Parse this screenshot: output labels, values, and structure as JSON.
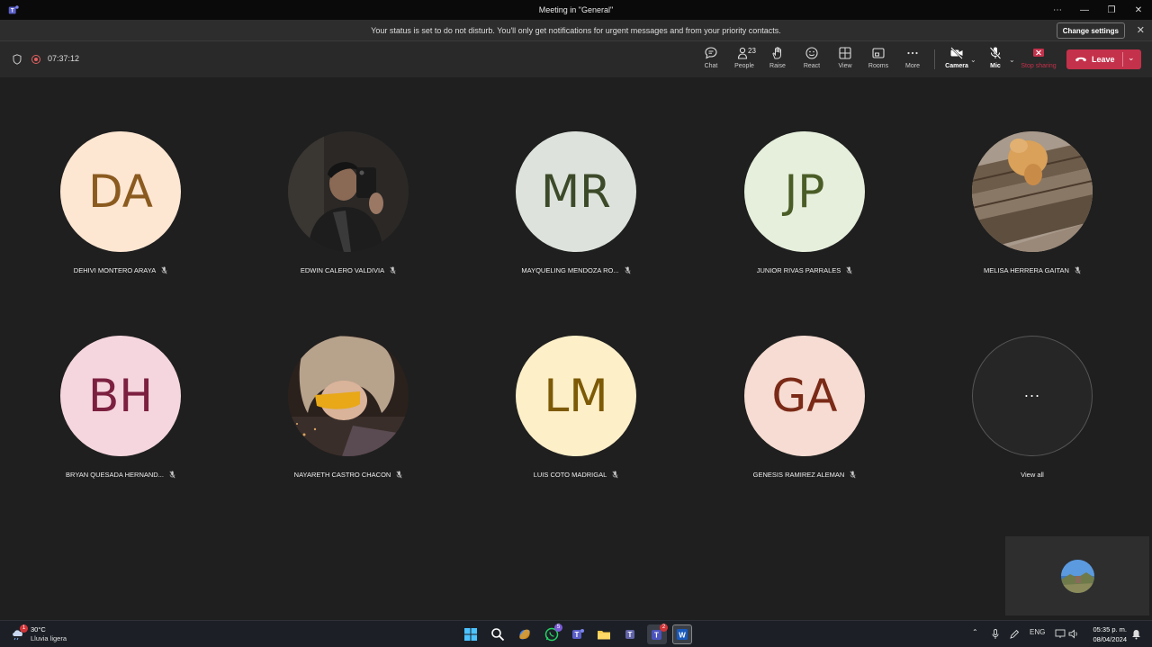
{
  "window": {
    "title": "Meeting in \"General\"",
    "controls": [
      "⋯",
      "—",
      "❐",
      "✕"
    ]
  },
  "notification": {
    "message": "Your status is set to do not disturb. You'll only get notifications for urgent messages and from your priority contacts.",
    "button": "Change settings",
    "close": "✕"
  },
  "meeting": {
    "elapsed": "07:37:12",
    "people_count": "23",
    "buttons": {
      "chat": "Chat",
      "people": "People",
      "raise": "Raise",
      "react": "React",
      "view": "View",
      "rooms": "Rooms",
      "more": "More",
      "camera": "Camera",
      "mic": "Mic",
      "stop_sharing": "Stop sharing",
      "leave": "Leave"
    }
  },
  "participants": [
    {
      "initials": "DA",
      "name": "DEHIVI MONTERO ARAYA",
      "bg": "#fde6d2",
      "fg": "#8a5a1f"
    },
    {
      "initials": "",
      "name": "EDWIN CALERO VALDIVIA",
      "bg": "#2a2a2a",
      "fg": "#ffffff"
    },
    {
      "initials": "MR",
      "name": "MAYQUELING MENDOZA RO...",
      "bg": "#dde3dc",
      "fg": "#3d4a2a"
    },
    {
      "initials": "JP",
      "name": "JUNIOR RIVAS PARRALES",
      "bg": "#e6efdc",
      "fg": "#4b5d27"
    },
    {
      "initials": "",
      "name": "MELISA HERRERA GAITAN",
      "bg": "#8a7a6a",
      "fg": "#ffffff"
    },
    {
      "initials": "BH",
      "name": "BRYAN QUESADA HERNAND...",
      "bg": "#f6d6de",
      "fg": "#7c2040"
    },
    {
      "initials": "",
      "name": "NAYARETH CASTRO CHACON",
      "bg": "#3a2a22",
      "fg": "#ffffff"
    },
    {
      "initials": "LM",
      "name": "LUIS COTO MADRIGAL",
      "bg": "#fdefc8",
      "fg": "#7d5a05"
    },
    {
      "initials": "GA",
      "name": "GENESIS RAMIREZ ALEMAN",
      "bg": "#f6dcd2",
      "fg": "#7a2a17"
    }
  ],
  "view_all": {
    "label": "View all",
    "dots": "..."
  },
  "taskbar": {
    "weather_temp": "30°C",
    "weather_cond": "Lluvia ligera",
    "weather_badge": "1",
    "whatsapp_badge": "5",
    "teams_badge": "2",
    "lang": "ENG",
    "time": "05:35 p. m.",
    "date": "08/04/2024"
  },
  "colors": {
    "accent_leave": "#c4314b",
    "stop_sharing": "#c4314b"
  }
}
